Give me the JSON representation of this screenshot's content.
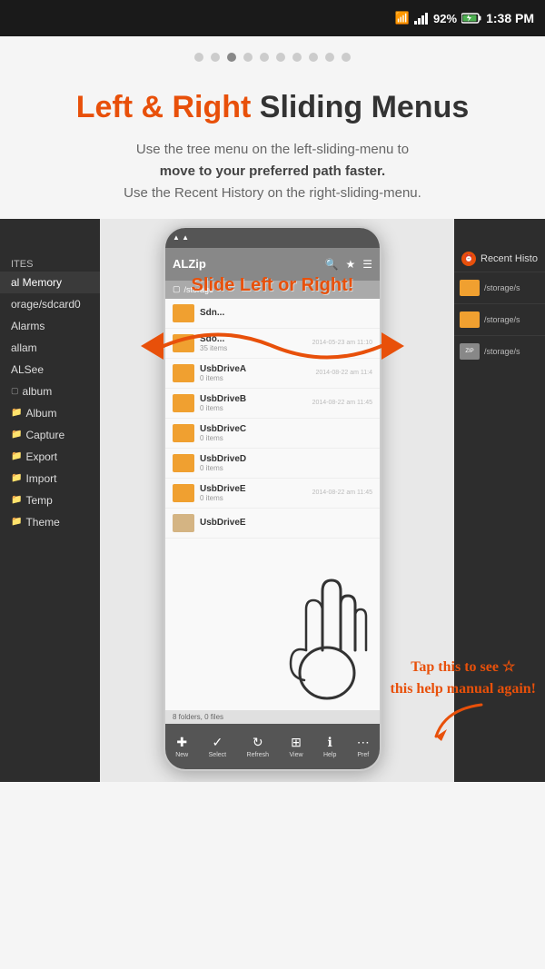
{
  "statusBar": {
    "time": "1:38 PM",
    "battery": "92%",
    "charging": true
  },
  "dots": {
    "total": 10,
    "active": 3
  },
  "hero": {
    "title_highlight": "Left & Right",
    "title_rest": " Sliding Menus",
    "subtitle_line1": "Use the tree menu on the left-sliding-menu to",
    "subtitle_bold": "move to your preferred path faster.",
    "subtitle_line2": "Use the Recent History on the right-sliding-menu."
  },
  "leftPanel": {
    "sectionTitle": "ites",
    "items": [
      {
        "label": "al Memory",
        "active": true
      },
      {
        "label": "orage/sdcard0",
        "active": false
      },
      {
        "label": "Alarms",
        "active": false
      },
      {
        "label": "allam",
        "active": false
      },
      {
        "label": "ALSee",
        "active": false
      },
      {
        "label": "album",
        "hasCheckbox": true,
        "active": false
      },
      {
        "label": "Album",
        "hasFolder": true,
        "active": false
      },
      {
        "label": "Capture",
        "hasFolder": true,
        "active": false
      },
      {
        "label": "Export",
        "hasFolder": true,
        "active": false
      },
      {
        "label": "Import",
        "hasFolder": true,
        "active": false
      },
      {
        "label": "Temp",
        "hasFolder": true,
        "active": false
      },
      {
        "label": "Theme",
        "hasFolder": true,
        "active": false
      }
    ]
  },
  "rightPanel": {
    "title": "Recent Histo",
    "items": [
      {
        "path": "/storage/s",
        "type": "folder"
      },
      {
        "path": "/storage/s",
        "type": "folder"
      },
      {
        "path": "/storage/s",
        "type": "zip"
      }
    ]
  },
  "centerPhone": {
    "appName": "ALZip",
    "breadcrumb": "storage",
    "files": [
      {
        "name": "Sdn...",
        "meta": "",
        "date": "",
        "type": "folder"
      },
      {
        "name": "Sdo...",
        "meta": "35 items",
        "date": "2014-05-23 am 11:10",
        "type": "folder"
      },
      {
        "name": "UsbDriveA",
        "meta": "0 items",
        "date": "2014-08-22 am 11:4",
        "type": "folder"
      },
      {
        "name": "UsbDriveB",
        "meta": "0 items",
        "date": "2014-08-22 am 11:45",
        "type": "folder"
      },
      {
        "name": "UsbDriveC",
        "meta": "0 items",
        "date": "",
        "type": "folder"
      },
      {
        "name": "UsbDriveD",
        "meta": "0 items",
        "date": "",
        "type": "folder"
      },
      {
        "name": "UsbDriveE",
        "meta": "0 items",
        "date": "2014-08-22 am 11:45",
        "type": "folder"
      },
      {
        "name": "UsbDriveE",
        "meta": "",
        "date": "",
        "type": "folder"
      }
    ],
    "footerCount": "8 folders, 0 files",
    "bottomButtons": [
      {
        "icon": "✚",
        "label": "New"
      },
      {
        "icon": "✓",
        "label": "Select"
      },
      {
        "icon": "↻",
        "label": "Refresh"
      },
      {
        "icon": "⊞",
        "label": "View"
      }
    ],
    "rightButtons": [
      {
        "icon": "ℹ",
        "label": "Help"
      },
      {
        "icon": "⋯",
        "label": "Pref"
      }
    ]
  },
  "annotations": {
    "slideText": "Slide Left or Right!",
    "tapText": "Tap this to see ☆\nthis help manual again!"
  }
}
